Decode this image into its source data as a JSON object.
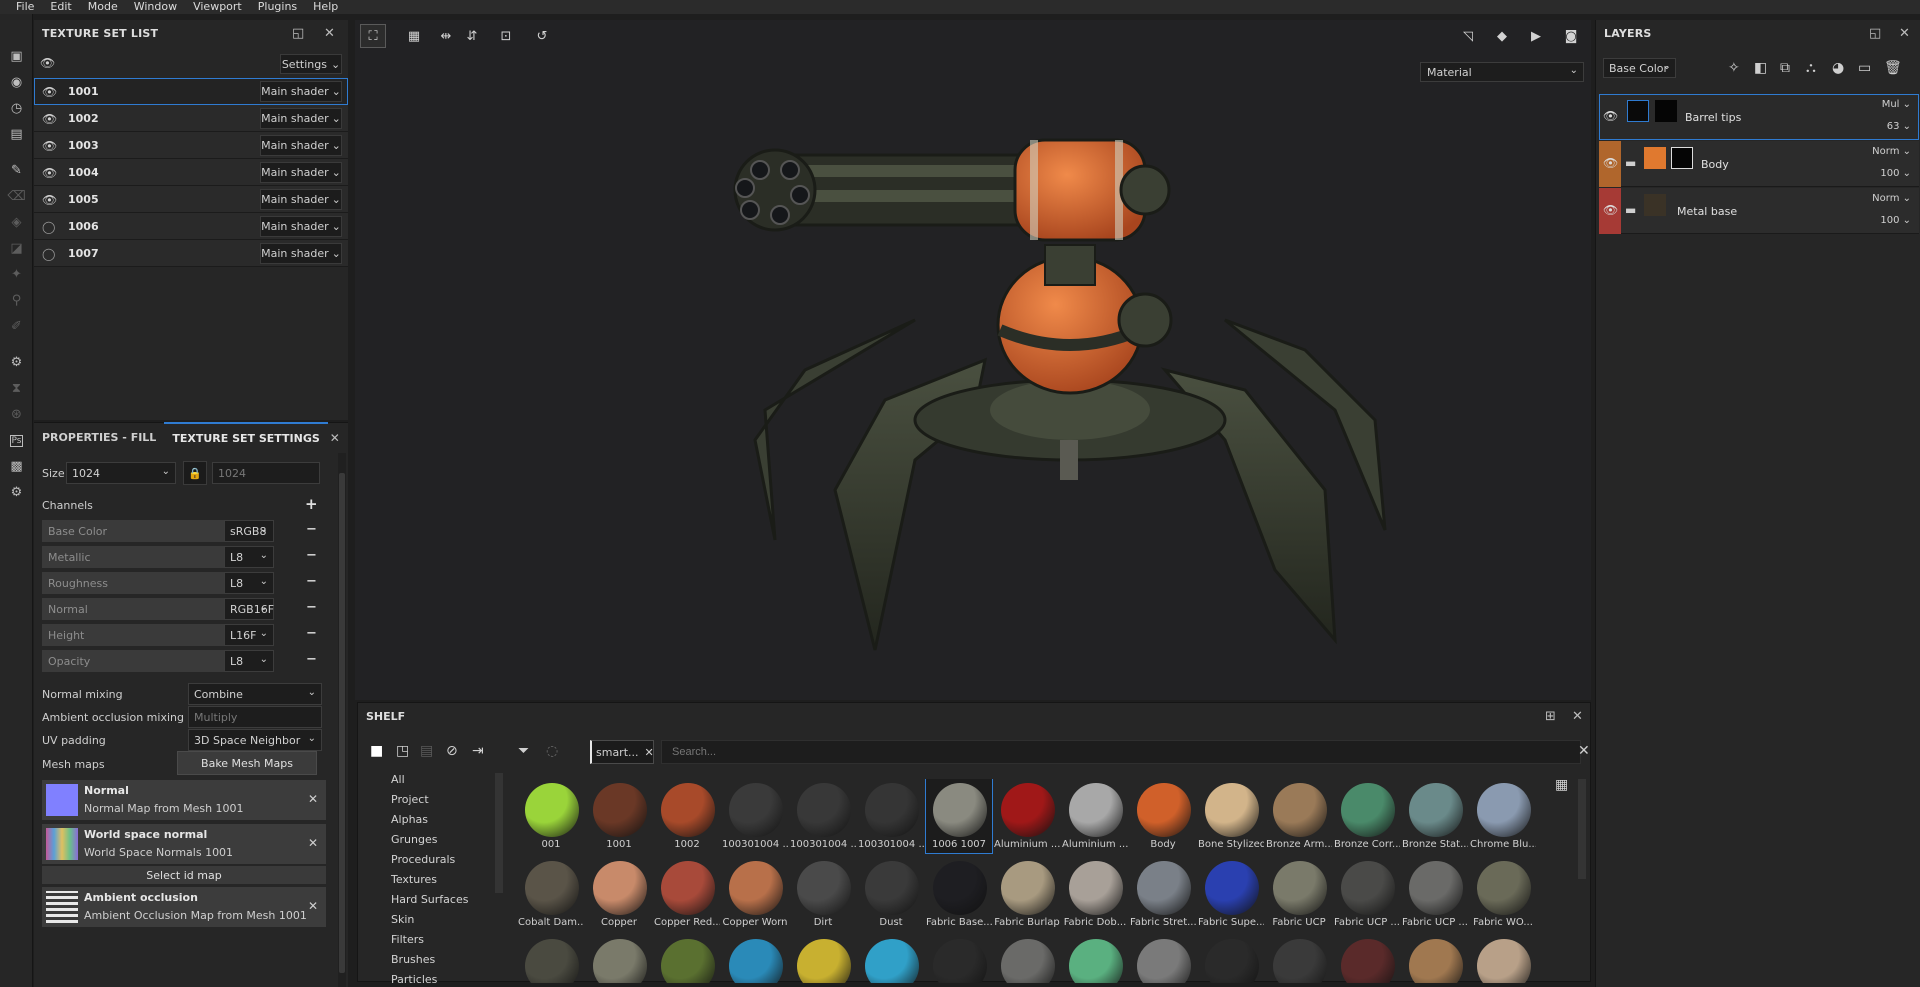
{
  "menu": [
    "File",
    "Edit",
    "Mode",
    "Window",
    "Viewport",
    "Plugins",
    "Help"
  ],
  "texture_set_list": {
    "title": "TEXTURE SET LIST",
    "settings_label": "Settings",
    "rows": [
      {
        "name": "1001",
        "shader": "Main shader",
        "visible": true
      },
      {
        "name": "1002",
        "shader": "Main shader",
        "visible": true
      },
      {
        "name": "1003",
        "shader": "Main shader",
        "visible": true
      },
      {
        "name": "1004",
        "shader": "Main shader",
        "visible": true
      },
      {
        "name": "1005",
        "shader": "Main shader",
        "visible": true
      },
      {
        "name": "1006",
        "shader": "Main shader",
        "visible": false
      },
      {
        "name": "1007",
        "shader": "Main shader",
        "visible": false
      }
    ]
  },
  "properties": {
    "tab_fill": "PROPERTIES - FILL",
    "tab_tss": "TEXTURE SET SETTINGS",
    "size_label": "Size",
    "size_value": "1024",
    "size_locked_value": "1024",
    "channels_label": "Channels",
    "channels": [
      {
        "name": "Base Color",
        "format": "sRGB8"
      },
      {
        "name": "Metallic",
        "format": "L8"
      },
      {
        "name": "Roughness",
        "format": "L8"
      },
      {
        "name": "Normal",
        "format": "RGB16F"
      },
      {
        "name": "Height",
        "format": "L16F"
      },
      {
        "name": "Opacity",
        "format": "L8"
      }
    ],
    "normal_mixing_label": "Normal mixing",
    "normal_mixing_value": "Combine",
    "ao_mixing_label": "Ambient occlusion mixing",
    "ao_mixing_value": "Multiply",
    "uv_padding_label": "UV padding",
    "uv_padding_value": "3D Space Neighbor",
    "mesh_maps_label": "Mesh maps",
    "bake_label": "Bake Mesh Maps",
    "select_id_label": "Select id map",
    "mesh_maps": [
      {
        "title": "Normal",
        "sub": "Normal Map from Mesh 1001"
      },
      {
        "title": "World space normal",
        "sub": "World Space Normals 1001"
      },
      {
        "title": "Ambient occlusion",
        "sub": "Ambient Occlusion Map from Mesh 1001"
      }
    ]
  },
  "viewport": {
    "material_mode": "Material"
  },
  "layers": {
    "title": "LAYERS",
    "channel": "Base Color",
    "items": [
      {
        "name": "Barrel tips",
        "blend": "Mul",
        "opacity": "63"
      },
      {
        "name": "Body",
        "blend": "Norm",
        "opacity": "100"
      },
      {
        "name": "Metal base",
        "blend": "Norm",
        "opacity": "100"
      }
    ]
  },
  "shelf": {
    "title": "SHELF",
    "filter_tag": "smart...",
    "search_placeholder": "Search...",
    "categories": [
      "All",
      "Project",
      "Alphas",
      "Grunges",
      "Procedurals",
      "Textures",
      "Hard Surfaces",
      "Skin",
      "Filters",
      "Brushes",
      "Particles"
    ],
    "row1": [
      "001",
      "1001",
      "1002",
      "100301004 ...",
      "100301004 ...",
      "100301004 ...",
      "1006 1007",
      "Aluminium ...",
      "Aluminium ...",
      "Body",
      "Bone Stylized",
      "Bronze Arm...",
      "Bronze Corr...",
      "Bronze Stat...",
      "Chrome Blu..."
    ],
    "row2": [
      "Cobalt Dam...",
      "Copper",
      "Copper Red...",
      "Copper Worn",
      "Dirt",
      "Dust",
      "Fabric Base...",
      "Fabric Burlap",
      "Fabric Dob...",
      "Fabric Stret...",
      "Fabric Supe...",
      "Fabric UCP",
      "Fabric UCP ...",
      "Fabric UCP ...",
      "Fabric WO..."
    ],
    "row3": [
      "",
      "",
      "",
      "",
      "",
      "",
      "",
      "",
      "",
      "",
      "",
      "",
      "",
      "",
      ""
    ]
  },
  "colors": {
    "accent": "#2f7bd1",
    "layer_body": "#e0792f",
    "layer_metal": "#a63a35",
    "layer_barrel": "#5a7ab8"
  }
}
